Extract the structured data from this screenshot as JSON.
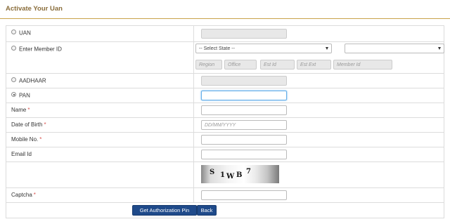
{
  "page": {
    "title": "Activate Your Uan"
  },
  "form": {
    "uan": {
      "label": "UAN"
    },
    "member": {
      "label": "Enter Member ID",
      "state_select": "-- Select State --",
      "region": "Region",
      "office": "Office",
      "est_id": "Est Id",
      "est_ext": "Est Ext",
      "member_id": "Member Id"
    },
    "aadhaar": {
      "label": "AADHAAR"
    },
    "pan": {
      "label": "PAN"
    },
    "name": {
      "label": "Name",
      "req": "*"
    },
    "dob": {
      "label": "Date of Birth",
      "req": "*",
      "placeholder": "DD/MM/YYYY"
    },
    "mobile": {
      "label": "Mobile No.",
      "req": "*"
    },
    "email": {
      "label": "Email Id"
    },
    "captcha_image": {
      "c1": "S",
      "c2": "1",
      "c3": "W",
      "c4": "B",
      "c5": "7"
    },
    "captcha": {
      "label": "Captcha",
      "req": "*"
    }
  },
  "buttons": {
    "get_pin": "Get Authorization Pin",
    "back": "Back"
  }
}
